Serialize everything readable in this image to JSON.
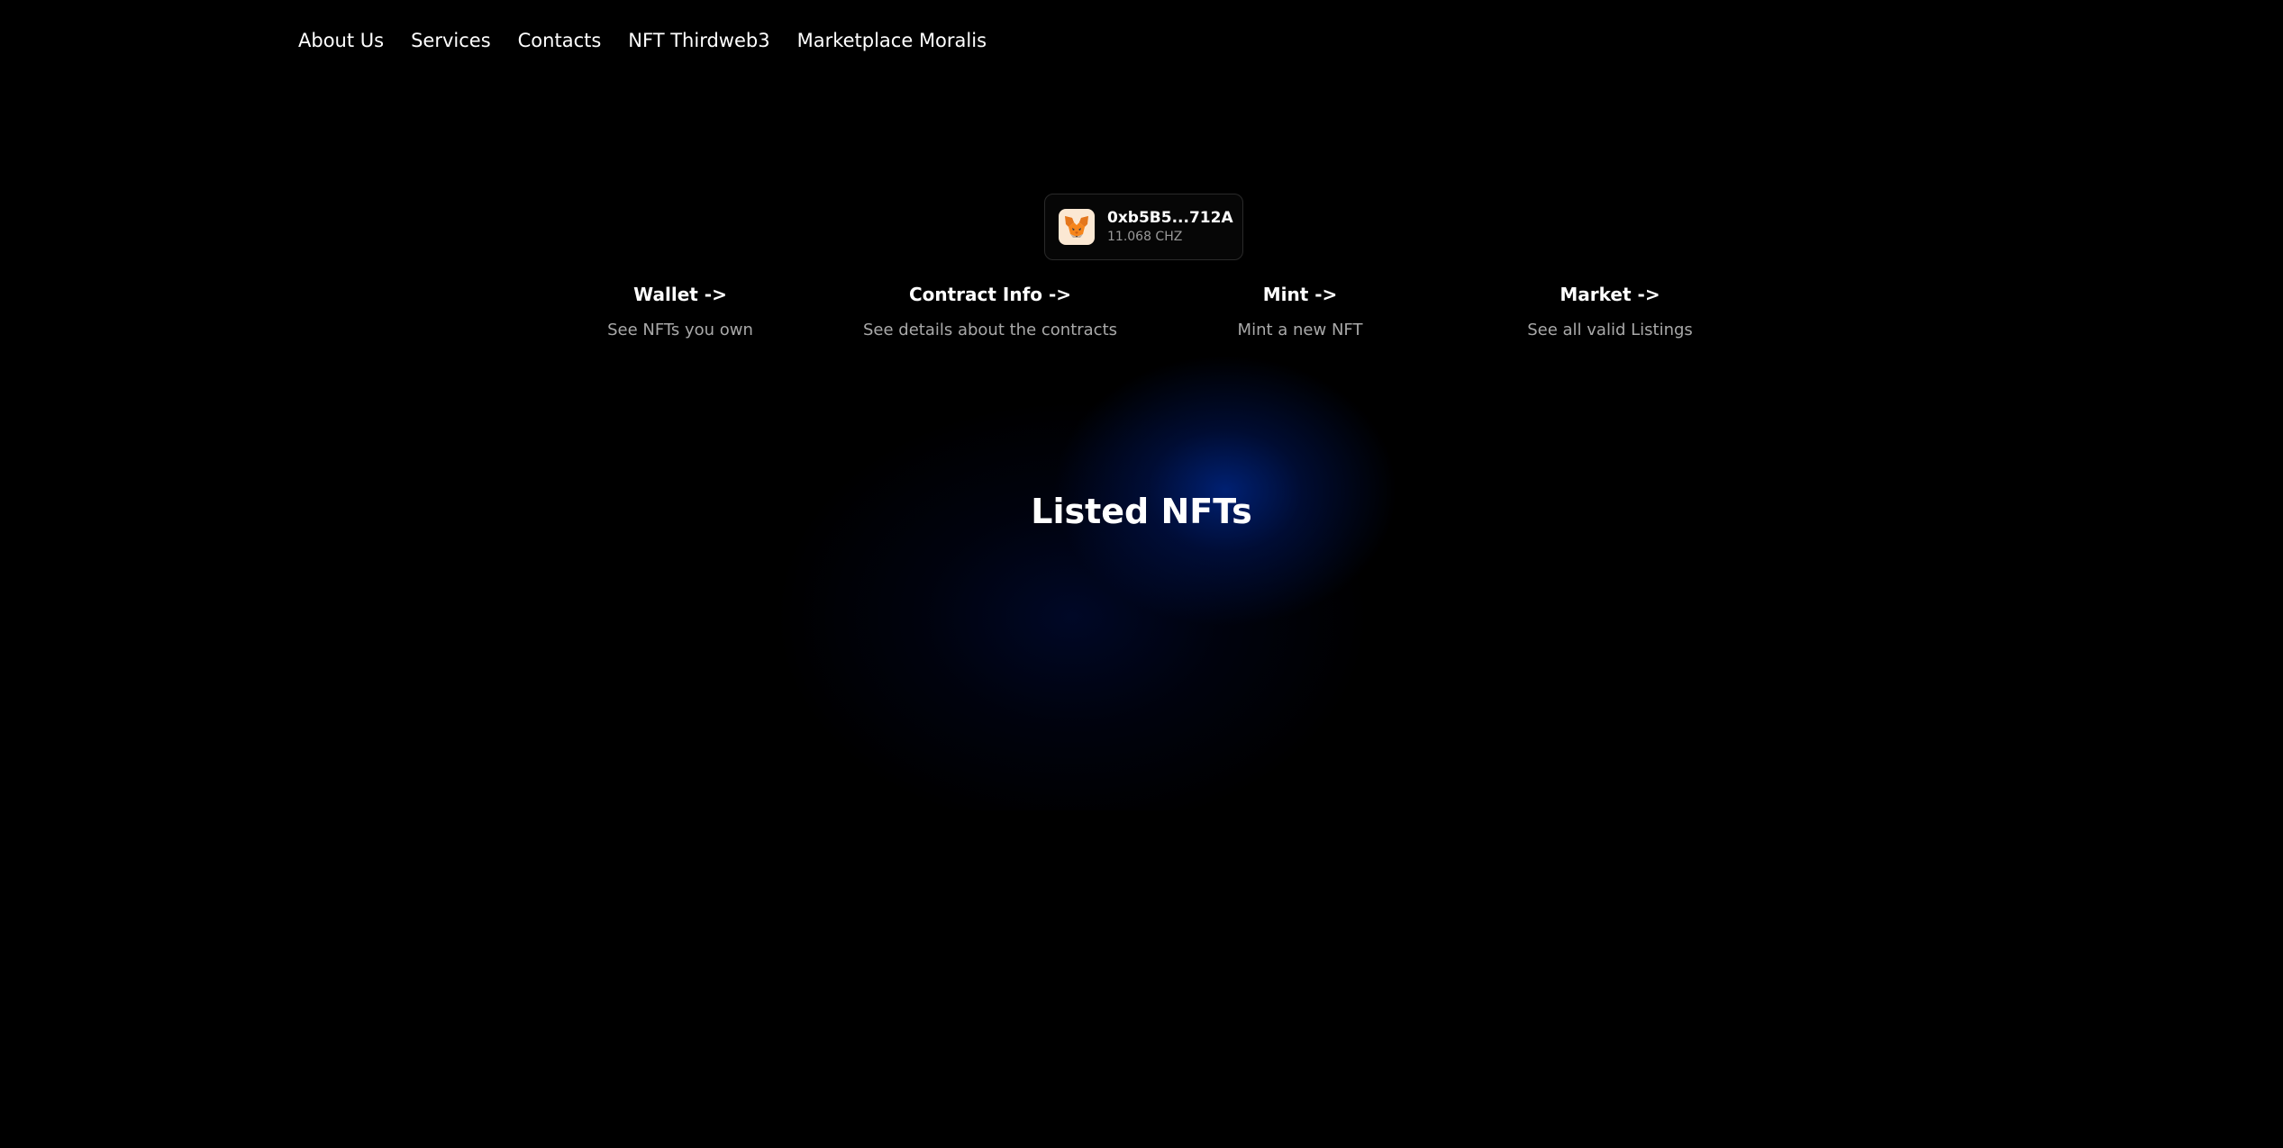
{
  "nav": {
    "items": [
      {
        "label": "About Us"
      },
      {
        "label": "Services"
      },
      {
        "label": "Contacts"
      },
      {
        "label": "NFT Thirdweb3"
      },
      {
        "label": "Marketplace Moralis"
      }
    ]
  },
  "wallet": {
    "icon": "metamask-fox-icon",
    "address": "0xb5B5...712A",
    "balance": "11.068 CHZ"
  },
  "cards": [
    {
      "title": "Wallet ->",
      "description": "See NFTs you own"
    },
    {
      "title": "Contract Info ->",
      "description": "See details about the contracts"
    },
    {
      "title": "Mint ->",
      "description": "Mint a new NFT"
    },
    {
      "title": "Market ->",
      "description": "See all valid Listings"
    }
  ],
  "main": {
    "heading": "Listed NFTs"
  },
  "colors": {
    "background": "#000000",
    "glow": "#00227a",
    "text": "#ffffff",
    "muted_text": "#a9a9a9"
  }
}
